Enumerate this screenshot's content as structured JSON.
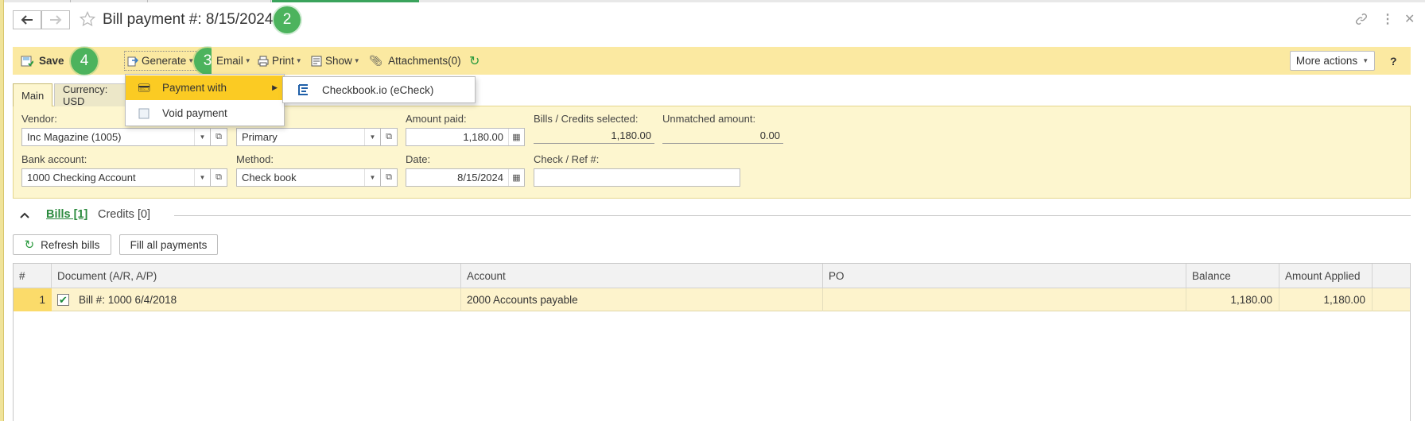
{
  "header": {
    "title": "Bill payment #: 8/15/2024",
    "badges": [
      "2",
      "3",
      "4"
    ]
  },
  "toolbar": {
    "save": "Save",
    "generate": "Generate",
    "email": "Email",
    "print": "Print",
    "show": "Show",
    "attachments": "Attachments(0)",
    "more_actions": "More actions",
    "help": "?"
  },
  "tabs": {
    "main": "Main",
    "currency": "Currency: USD"
  },
  "menu": {
    "payment_with": "Payment with",
    "void_payment": "Void payment",
    "submenu_checkbook": "Checkbook.io (eCheck)"
  },
  "form": {
    "vendor_label": "Vendor:",
    "vendor_value": "Inc Magazine (1005)",
    "contact_value": "Primary",
    "amount_paid_label": "Amount paid:",
    "amount_paid_value": "1,180.00",
    "bills_selected_label": "Bills / Credits selected:",
    "bills_selected_value": "1,180.00",
    "unmatched_label": "Unmatched amount:",
    "unmatched_value": "0.00",
    "bank_label": "Bank account:",
    "bank_value": "1000 Checking Account",
    "method_label": "Method:",
    "method_value": "Check book",
    "date_label": "Date:",
    "date_value": "8/15/2024",
    "check_ref_label": "Check / Ref #:",
    "check_ref_value": ""
  },
  "section": {
    "bills_tab": "Bills [1]",
    "credits_tab": "Credits [0]",
    "refresh_bills": "Refresh bills",
    "fill_all": "Fill all payments"
  },
  "grid": {
    "columns": [
      "#",
      "Document (A/R, A/P)",
      "Account",
      "PO",
      "Balance",
      "Amount Applied"
    ],
    "rows": [
      {
        "num": "1",
        "document": "Bill #: 1000 6/4/2018",
        "account": "2000 Accounts payable",
        "po": "",
        "balance": "1,180.00",
        "applied": "1,180.00",
        "checked": true
      }
    ]
  },
  "colors": {
    "toolbar_bg": "#fbe9a1",
    "form_bg": "#fdf6cf",
    "menu_highlight": "#fbcb23",
    "badge": "#4cb35d",
    "link_green": "#2b8a3e"
  }
}
